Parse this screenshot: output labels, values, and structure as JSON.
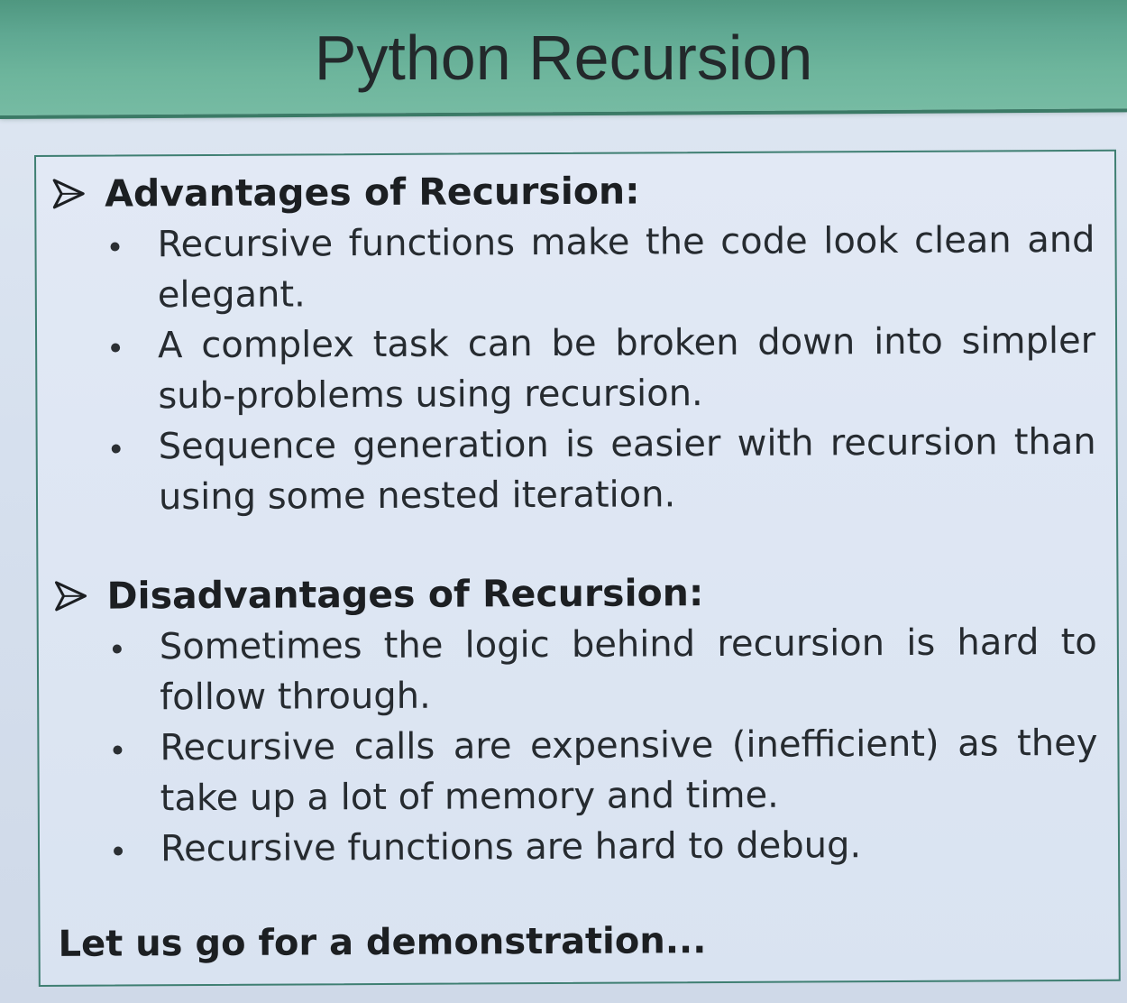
{
  "slide": {
    "title": "Python Recursion"
  },
  "advantages": {
    "heading": "Advantages of Recursion:",
    "items": [
      "Recursive functions make the code look clean and elegant.",
      "A complex task can be broken down into simpler sub-problems using recursion.",
      "Sequence generation is easier with recursion than using some nested iteration."
    ]
  },
  "disadvantages": {
    "heading": "Disadvantages of Recursion:",
    "items": [
      "Sometimes the logic behind recursion is hard to follow through.",
      "Recursive calls are expensive (inefficient) as they take up a lot of memory and time.",
      "Recursive functions are hard to debug."
    ]
  },
  "closing": "Let us go for a demonstration...",
  "colors": {
    "title_band": "#5fa892",
    "box_border": "#3f7f72",
    "text": "#262b30"
  },
  "icons": {
    "section_marker": "arrowhead-bullet-icon",
    "item_marker": "round-bullet-icon"
  }
}
